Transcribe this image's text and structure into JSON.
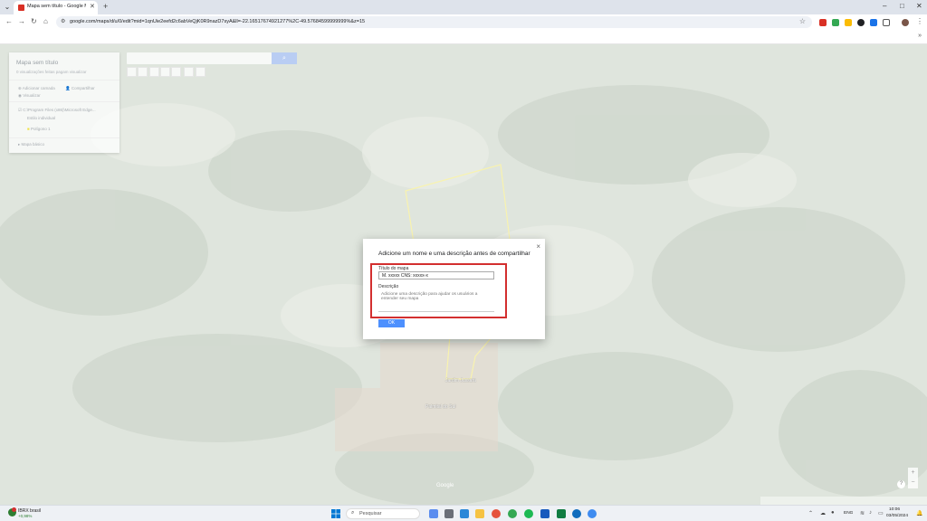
{
  "browser": {
    "tab_title": "Mapa sem título - Google My M",
    "url": "google.com/maps/d/u/0/edit?mid=1qnUie2eefd2c6abVeQjK0R9nazD7syA&ll=-22.16517674921277%2C-49.57684599999999%&z=15",
    "window_controls": [
      "–",
      "□",
      "✕"
    ]
  },
  "map_panel": {
    "title": "Mapa sem título",
    "subtitle": "0 visualizações feitas pagam visualizar",
    "add_layer": "Adicionar camada",
    "share": "Compartilhar",
    "preview": "Visualizar",
    "layer_name": "C:\\Program Files (x86)\\Microsoft Edge...",
    "layer_style": "Estilo individual",
    "feature": "Polígono 1",
    "base_map": "Mapa básico"
  },
  "map": {
    "search_btn_icon": "search-icon",
    "labels": [
      "Jardim Jussara",
      "Palmital do Sul"
    ],
    "watermark": "Google",
    "polygon_color": "#f0e34a"
  },
  "dialog": {
    "title": "Adicione um nome e uma descrição antes de compartilhar",
    "close": "×",
    "map_title_label": "Título do mapa",
    "map_title_value": "M. xxxxx CNS: xxxxx-x",
    "description_label": "Descrição",
    "description_placeholder": "Adicione uma descrição para ajudar os usuários a entender seu mapa",
    "ok_label": "OK",
    "highlight_color": "#d32f2f"
  },
  "taskbar": {
    "weather_title": "IBRX brasil",
    "weather_value": "+0,98%",
    "search_placeholder": "Pesquisar",
    "language": "ENG",
    "time": "10:06",
    "date": "03/05/2024"
  }
}
